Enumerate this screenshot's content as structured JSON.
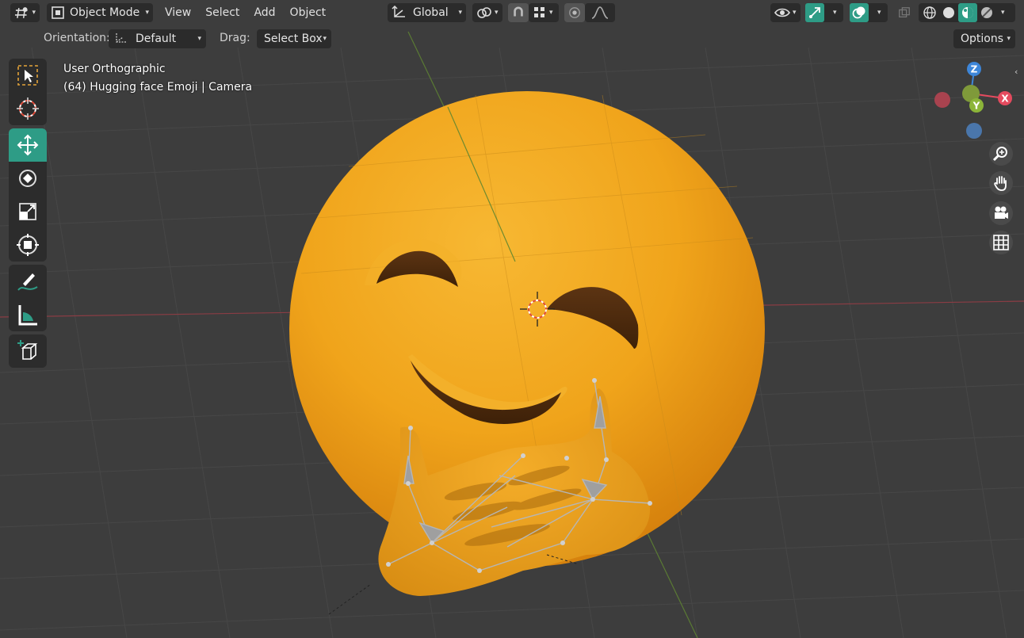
{
  "header": {
    "mode_label": "Object Mode",
    "menus": [
      "View",
      "Select",
      "Add",
      "Object"
    ],
    "transform_orientation": "Global",
    "options_label": "Options"
  },
  "tool_settings": {
    "orientation_label": "Orientation:",
    "orientation_value": "Default",
    "drag_label": "Drag:",
    "drag_value": "Select Box"
  },
  "viewport": {
    "view_name": "User Orthographic",
    "object_info": "(64) Hugging face Emoji | Camera"
  },
  "gizmo": {
    "axes": [
      "Z",
      "Y",
      "X"
    ],
    "colors": {
      "x": "#e44a5e",
      "y": "#8cb539",
      "z": "#3d86d9",
      "neg_x": "#a8434f",
      "neg_z": "#4a76ab"
    }
  },
  "toolbar": {
    "tools": [
      "select-box-icon",
      "cursor-icon",
      "move-icon",
      "rotate-icon",
      "scale-icon",
      "transform-icon",
      "annotate-icon",
      "measure-icon",
      "add-cube-icon"
    ],
    "active_tool": "move-icon"
  },
  "colors": {
    "accent": "#2e9c86",
    "background": "#3d3d3d",
    "emoji": "#f0a81e"
  }
}
